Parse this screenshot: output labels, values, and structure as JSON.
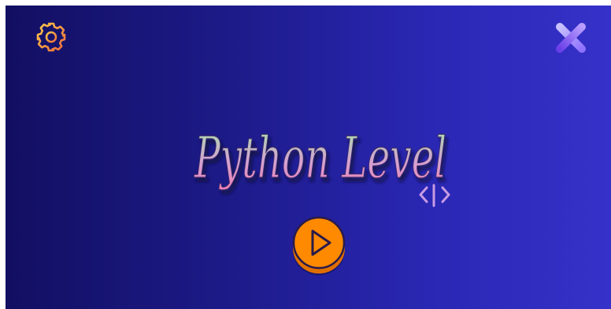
{
  "game": {
    "title": "Python Level"
  },
  "icons": {
    "settings": "gear-icon",
    "close": "close-icon",
    "code": "code-brackets-icon",
    "play": "play-icon"
  },
  "colors": {
    "background_left": "#120f62",
    "background_right": "#3631c9",
    "settings_gradient": [
      "#f7c94a",
      "#f06a3d"
    ],
    "close_gradient": [
      "#b6a9ff",
      "#7a4df2"
    ],
    "title_gradient": [
      "#9fe0a6",
      "#d6a0cf",
      "#ef7fb7"
    ],
    "play_button": "#ff8a00",
    "play_button_dark": "#e06f00"
  }
}
